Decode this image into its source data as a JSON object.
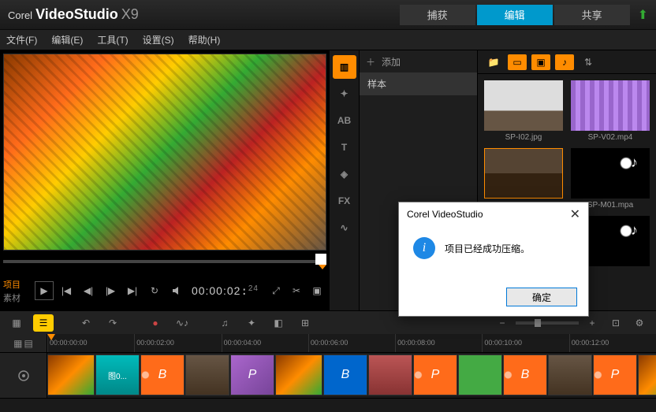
{
  "app": {
    "brand": "Corel",
    "product": "VideoStudio",
    "version": "X9"
  },
  "mainTabs": {
    "capture": "捕获",
    "edit": "编辑",
    "share": "共享"
  },
  "menu": {
    "file": "文件(F)",
    "edit": "编辑(E)",
    "tools": "工具(T)",
    "settings": "设置(S)",
    "help": "帮助(H)"
  },
  "preview": {
    "modeProject": "项目",
    "modeClip": "素材",
    "timecode": "00:00:02",
    "timecodeFrames": "24"
  },
  "libraryFolders": {
    "add": "添加",
    "sample": "样本"
  },
  "libraryItems": {
    "i1": "SP-I02.jpg",
    "v1": "SP-V02.mp4",
    "m1": "SP-M01.mpa"
  },
  "dialog": {
    "title": "Corel VideoStudio",
    "message": "项目已经成功压缩。",
    "ok": "确定"
  },
  "ruler": {
    "t0": "00:00:00:00",
    "t1": "00:00:02:00",
    "t2": "00:00:04:00",
    "t3": "00:00:06:00",
    "t4": "00:00:08:00",
    "t5": "00:00:10:00",
    "t6": "00:00:12:00"
  },
  "clips": {
    "label": "图0...",
    "b": "B",
    "p": "P"
  }
}
